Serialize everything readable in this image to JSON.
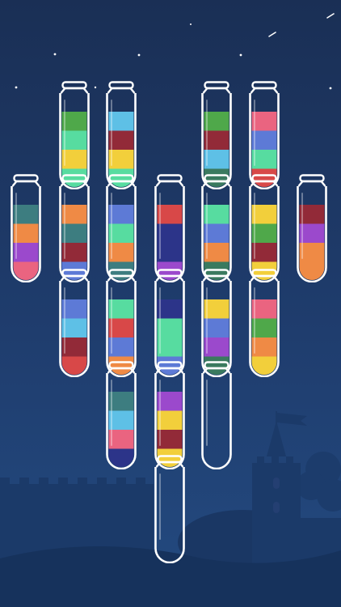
{
  "game": {
    "title": "",
    "colors": {
      "green": "#4fa84a",
      "darkgreen": "#3a7a5f",
      "mint": "#57dca0",
      "yellow": "#f2cf3b",
      "red": "#d84848",
      "maroon": "#922a38",
      "blue": "#5d7ad6",
      "navy": "#2c3489",
      "sky": "#5ec0e6",
      "pink": "#ea6480",
      "purple": "#9b49cc",
      "orange": "#ef8a45",
      "teal": "#3d7d80"
    },
    "tubes": [
      {
        "id": "tube-1",
        "layers": [
          "green",
          "mint",
          "yellow",
          "mint"
        ]
      },
      {
        "id": "tube-2",
        "layers": [
          "sky",
          "maroon",
          "yellow",
          "mint"
        ]
      },
      {
        "id": "tube-3",
        "layers": [
          "green",
          "maroon",
          "sky",
          "darkgreen"
        ]
      },
      {
        "id": "tube-4",
        "layers": [
          "pink",
          "blue",
          "mint",
          "red"
        ]
      },
      {
        "id": "tube-5",
        "layers": [
          "teal",
          "orange",
          "purple",
          "pink"
        ]
      },
      {
        "id": "tube-6",
        "layers": [
          "orange",
          "teal",
          "maroon",
          "blue"
        ]
      },
      {
        "id": "tube-7",
        "layers": [
          "blue",
          "mint",
          "orange",
          "teal"
        ]
      },
      {
        "id": "tube-8",
        "layers": [
          "red",
          "navy",
          "navy",
          "purple"
        ]
      },
      {
        "id": "tube-9",
        "layers": [
          "mint",
          "blue",
          "orange",
          "darkgreen"
        ]
      },
      {
        "id": "tube-10",
        "layers": [
          "yellow",
          "green",
          "maroon",
          "yellow"
        ]
      },
      {
        "id": "tube-11",
        "layers": [
          "maroon",
          "purple",
          "orange",
          "orange"
        ]
      },
      {
        "id": "tube-12",
        "layers": [
          "blue",
          "sky",
          "maroon",
          "red"
        ]
      },
      {
        "id": "tube-13",
        "layers": [
          "mint",
          "red",
          "blue",
          "orange"
        ]
      },
      {
        "id": "tube-14",
        "layers": [
          "navy",
          "mint",
          "mint",
          "blue"
        ]
      },
      {
        "id": "tube-15",
        "layers": [
          "yellow",
          "blue",
          "purple",
          "darkgreen"
        ]
      },
      {
        "id": "tube-16",
        "layers": [
          "pink",
          "green",
          "orange",
          "yellow"
        ]
      },
      {
        "id": "tube-17",
        "layers": [
          "teal",
          "sky",
          "pink",
          "navy"
        ]
      },
      {
        "id": "tube-18",
        "layers": [
          "purple",
          "yellow",
          "maroon",
          "yellow"
        ]
      },
      {
        "id": "tube-19",
        "layers": []
      },
      {
        "id": "tube-20",
        "layers": []
      }
    ]
  },
  "theme": {
    "glass": "#ffffff",
    "silhouette": "#1a3866",
    "silhouette_dark": "#16315a",
    "star": "#ffffff"
  }
}
